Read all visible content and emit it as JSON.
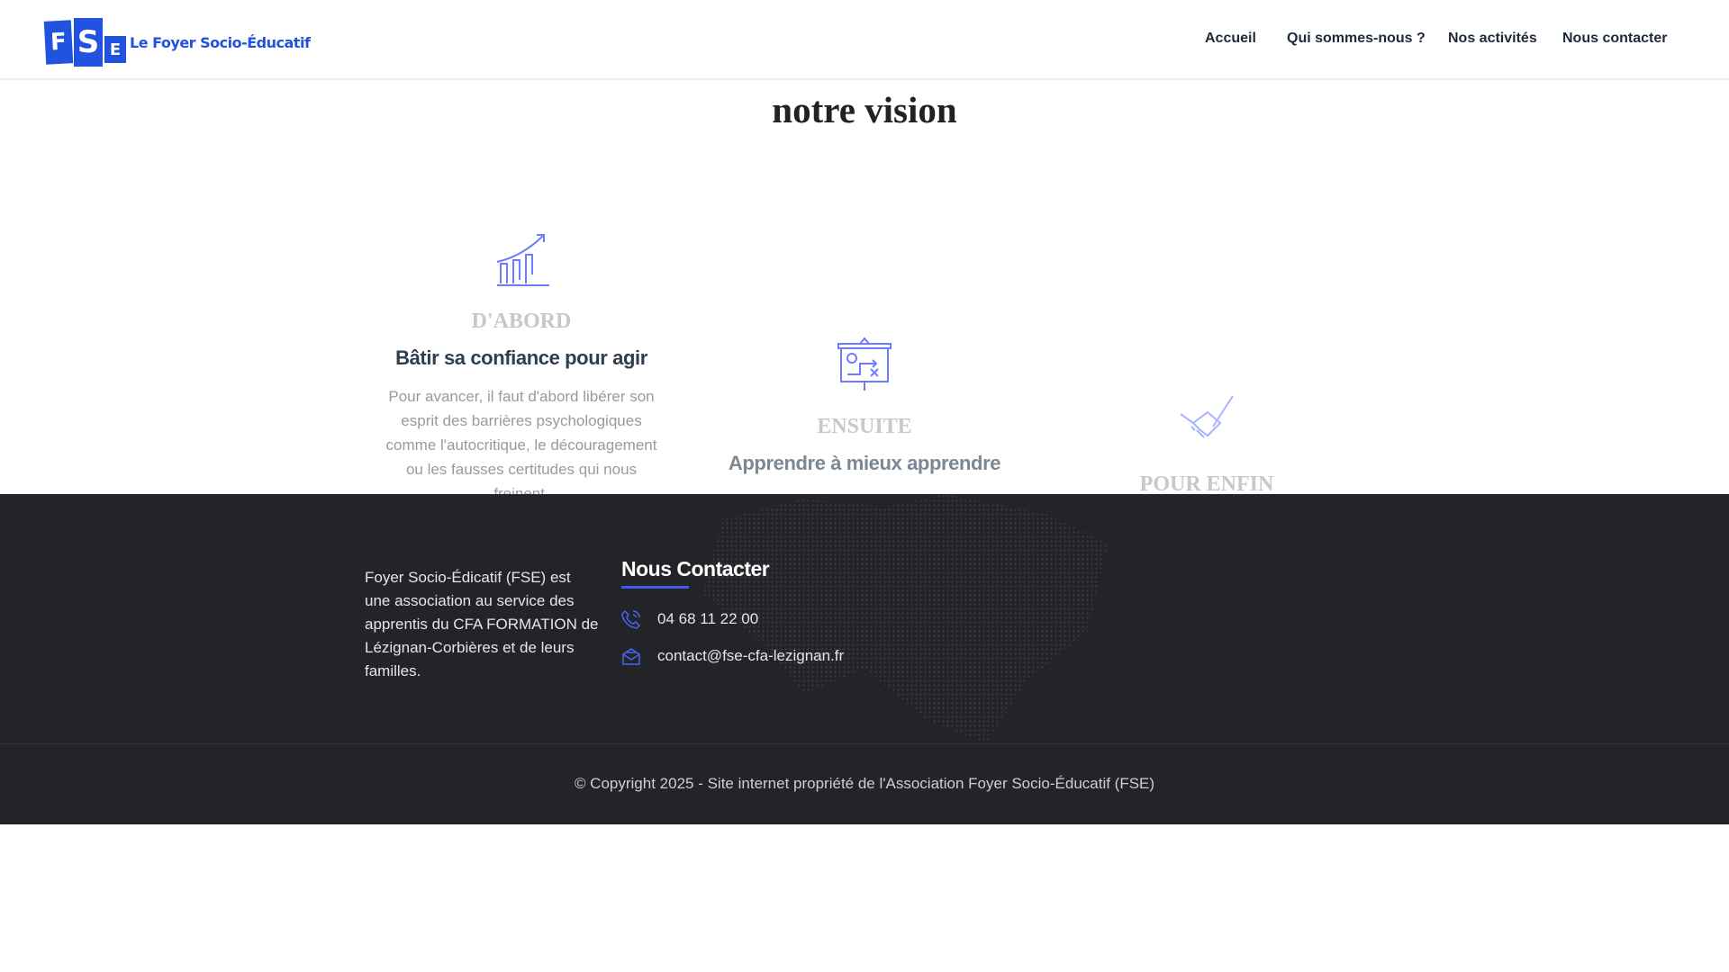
{
  "header": {
    "logo_text": "Le Foyer Socio-Éducatif",
    "logo_letters": [
      "F",
      "S",
      "E"
    ],
    "nav": [
      "Accueil",
      "Qui sommes-nous ?",
      "Nos activités",
      "Nous contacter"
    ]
  },
  "main": {
    "title": "notre vision",
    "columns": [
      {
        "icon": "growth-chart-icon",
        "kicker": "D'ABORD",
        "heading": "Bâtir sa confiance pour agir",
        "body": "Pour avancer, il faut d'abord libérer son esprit des barrières psychologiques comme l'autocritique, le découragement ou les fausses certitudes qui nous freinent."
      },
      {
        "icon": "strategy-board-icon",
        "kicker": "ENSUITE",
        "heading": "Apprendre à mieux apprendre"
      },
      {
        "icon": "handshake-icon",
        "kicker": "POUR ENFIN"
      }
    ]
  },
  "footer": {
    "about": "Foyer Socio-Édicatif (FSE) est une association au service des apprentis du CFA FORMATION de Lézignan-Corbières et de leurs familles.",
    "contact_title": "Nous Contacter",
    "phone": "04 68 11 22 00",
    "email": "contact@fse-cfa-lezignan.fr",
    "copyright": "© Copyright 2025 - Site internet propriété de l'Association Foyer Socio-Éducatif (FSE)"
  },
  "colors": {
    "accent": "#3d5af1",
    "icon": "#6b7cff",
    "footer_bg": "#232428"
  }
}
